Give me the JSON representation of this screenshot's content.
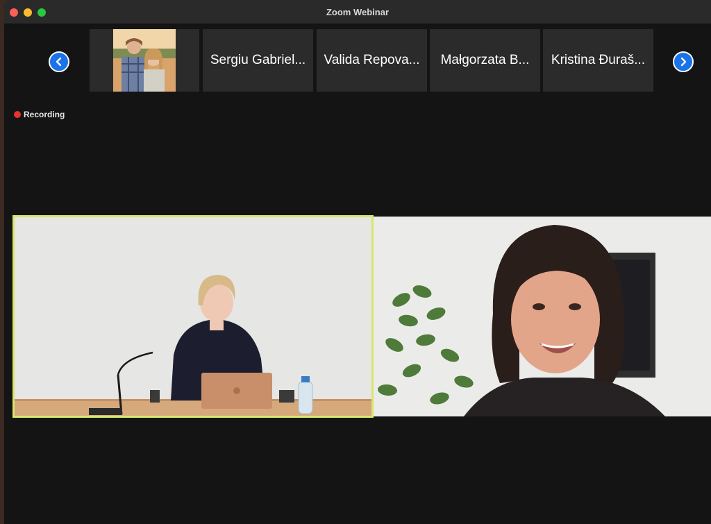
{
  "window": {
    "title": "Zoom Webinar",
    "colors": {
      "close": "#fe5f57",
      "minimize": "#febc2e",
      "maximize": "#28c840",
      "nav_button": "#1a73e8",
      "active_speaker_border": "#d9e66a",
      "recording_dot": "#e8332c"
    }
  },
  "strip": {
    "prev_icon": "chevron-left-icon",
    "next_icon": "chevron-right-icon",
    "tiles": [
      {
        "label": "Sergiu Gabriel..."
      },
      {
        "label": "Valida Repova..."
      },
      {
        "label": "Małgorzata B..."
      },
      {
        "label": "Kristina Đuraš..."
      }
    ]
  },
  "status": {
    "recording": "Recording"
  }
}
